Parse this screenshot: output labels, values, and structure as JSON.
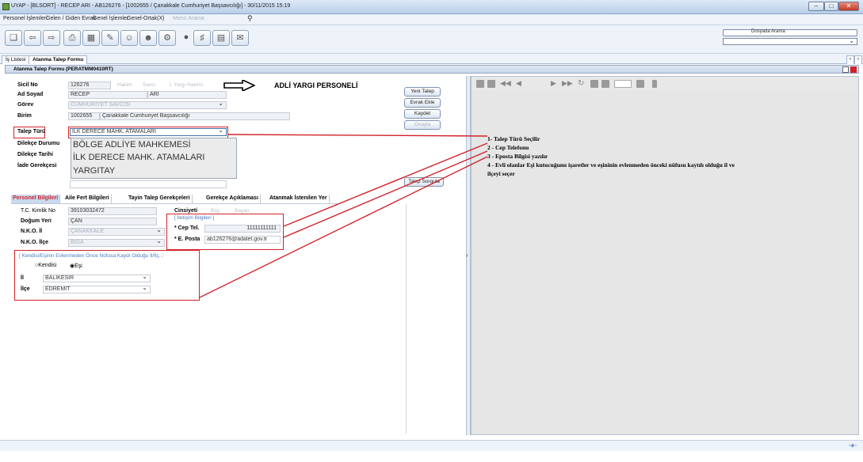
{
  "window": {
    "title": "UYAP - [BLSORT] - RECEP ARI - AB126276 - [1002655 / Çanakkale Cumhuriyet Başsavcılığı] - 30/11/2015 15:19"
  },
  "menu": [
    "Personel İşlemleri",
    "Gelen / Giden Evrak",
    "Genel İşlemler",
    "Genel-Ortak(X)",
    "Menü Arama"
  ],
  "toolbar": {
    "search_label": "Dosyada Arama"
  },
  "tabs": [
    "İş Listesi",
    "Atanma Talep Formu"
  ],
  "form_header": "Atanma Talep Formu (PERATMM0410RT)",
  "fields": {
    "sicil_no_label": "Sicil No",
    "sicil_no": "126276",
    "radio_hakim": "Hakim",
    "radio_savci": "Savcı",
    "radio_yargi": "İ. Yargı Hakimi",
    "ad_soyad_label": "Ad Soyad",
    "ad": "RECEP",
    "soyad": "ARI",
    "gorev_label": "Görev",
    "gorev": "CUMHURİYET SAVCISI",
    "birim_label": "Birim",
    "birim_kod": "1002655",
    "birim": "Çanakkale Cumhuriyet Başsavcılığı",
    "talep_turu_label": "Talep Türü",
    "talep_turu": "İLK DERECE MAHK. ATAMALARI",
    "dilekce_durumu_label": "Dilekçe Durumu",
    "dilekce_tarihi_label": "Dilekçe Tarihi",
    "iade_label": "İade Gerekçesi"
  },
  "dropdown_options": [
    "BÖLGE ADLİYE MAHKEMESİ",
    "İLK DERECE MAHK. ATAMALARI",
    "YARGITAY"
  ],
  "annotation_title": "ADLİ YARGI PERSONELİ",
  "buttons": {
    "yeni_talep": "Yeni Talep",
    "evrak_ekle": "Evrak Ekle",
    "kaydet": "Kaydet",
    "onayla": "Onayla",
    "talep_sorgula": "Talep Sorgula"
  },
  "panel_tabs": [
    "Personel Bilgileri",
    "Aile Fert Bilgileri",
    "Tayin Talep Gerekçeleri",
    "Gerekçe Açıklaması",
    "Atanmak İstenilen Yer"
  ],
  "personel": {
    "tc_label": "T.C. Kimlik No",
    "tc": "39103032472",
    "dogum_yeri_label": "Doğum Yeri",
    "dogum_yeri": "ÇAN",
    "nko_il_label": "N.K.O. İl",
    "nko_il": "ÇANAKKALE",
    "nko_ilce_label": "N.K.O. İlçe",
    "nko_ilce": "BİGA",
    "cinsiyet_label": "Cinsiyeti",
    "cinsiyet_bay": "Bay",
    "cinsiyet_bayan": "Bayan",
    "iletisim_legend": "[ İletişim Bilgileri ]",
    "cep_label": "* Cep Tel.",
    "cep": "11111111111",
    "eposta_label": "* E. Posta",
    "eposta": "ab126276@adalet.gov.tr",
    "nufus_legend": "[ Kendisi/Eşinin Evlenmeden Önce Nüfusa Kaydı Olduğu İl/İlç...",
    "kendisi": "Kendisi",
    "esi": "Eşi",
    "il_label": "İl",
    "il": "BALIKESİR",
    "ilce_label": "İlçe",
    "ilce": "EDREMİT"
  },
  "notes": [
    "1- Talep Türü Seçilir",
    "2 - Cep Telefonu",
    "3 - Eposta Bilgisi yazılır",
    "4 - Evli olanlar Eşi kutucuğunu işaretler ve eşininin evlenmeden önceki nüfusu kaytılı olduğu il ve",
    "ilçeyi seçer"
  ],
  "colors": {
    "highlight": "#d2232a",
    "panel": "#e6e6e6"
  }
}
